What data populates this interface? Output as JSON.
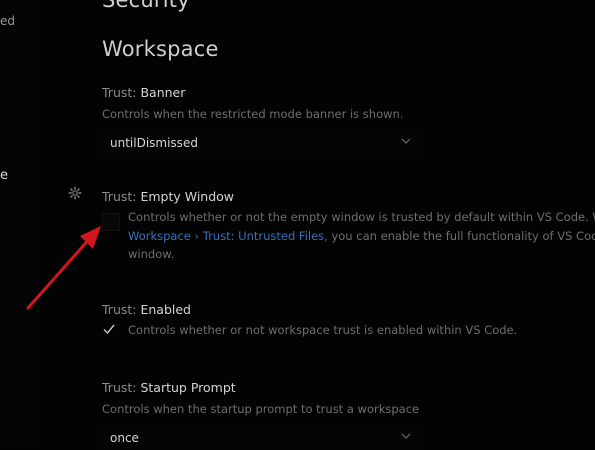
{
  "left_pane": {
    "line1": "ed",
    "line2": "e"
  },
  "sections": {
    "security": "Security",
    "workspace": "Workspace"
  },
  "settings": {
    "banner": {
      "category": "Trust: ",
      "name": "Banner",
      "description": "Controls when the restricted mode banner is shown.",
      "value": "untilDismissed"
    },
    "empty_window": {
      "category": "Trust: ",
      "name": "Empty Window",
      "description_line1": "Controls whether or not the empty window is trusted by default within VS Code. W",
      "link_text": "Workspace › Trust: Untrusted Files",
      "description_line2_rest": ", you can enable the full functionality of VS Cod",
      "description_line3": "window.",
      "checked": false
    },
    "enabled": {
      "category": "Trust: ",
      "name": "Enabled",
      "description": "Controls whether or not workspace trust is enabled within VS Code.",
      "checked": true
    },
    "startup_prompt": {
      "category": "Trust: ",
      "name": "Startup Prompt",
      "description": "Controls when the startup prompt to trust a workspace",
      "value": "once"
    }
  },
  "icons": {
    "gear": "gear-icon",
    "chevron": "chevron-down-icon",
    "check": "check-icon",
    "arrow": "red-arrow-annotation"
  },
  "colors": {
    "background": "#030303",
    "link": "#3b6fb5",
    "arrow": "#d0161e"
  }
}
